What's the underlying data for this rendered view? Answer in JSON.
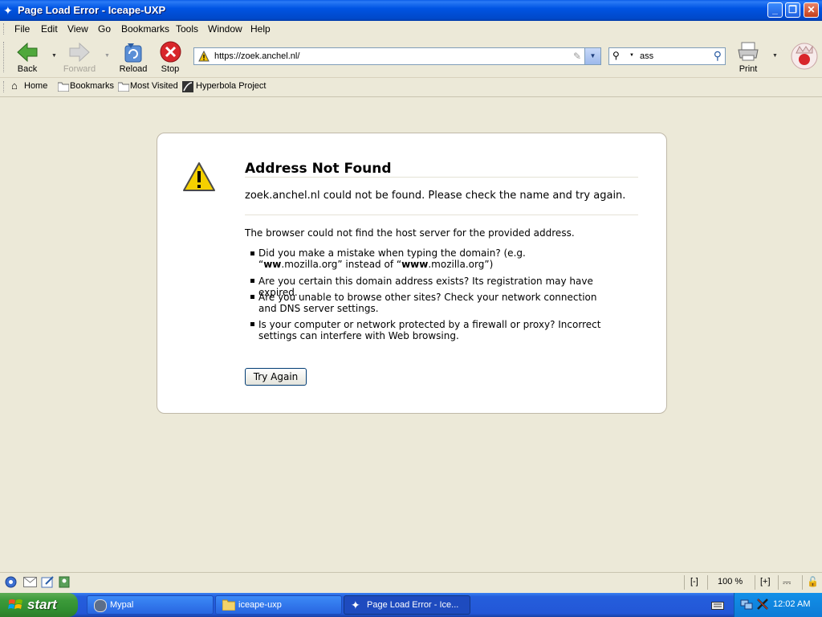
{
  "window": {
    "title": "Page Load Error - Iceape-UXP",
    "controls": [
      "minimize",
      "maximize",
      "close"
    ]
  },
  "menu": [
    "File",
    "Edit",
    "View",
    "Go",
    "Bookmarks",
    "Tools",
    "Window",
    "Help"
  ],
  "navbar": {
    "back": "Back",
    "forward": "Forward",
    "reload": "Reload",
    "stop": "Stop",
    "print": "Print",
    "url": "https://zoek.anchel.nl/",
    "search_value": "ass"
  },
  "bookmarks_bar": [
    "Home",
    "Bookmarks",
    "Most Visited",
    "Hyperbola Project"
  ],
  "error": {
    "title": "Address Not Found",
    "short_desc": "zoek.anchel.nl could not be found. Please check the name and try again.",
    "long_desc": "The browser could not find the host server for the provided address.",
    "bullets": [
      {
        "pre": "Did you make a mistake when typing the domain? (e.g. “",
        "b1": "ww",
        "mid1": ".mozilla.org” instead of “",
        "b2": "www",
        "post": ".mozilla.org”)"
      },
      {
        "text": "Are you certain this domain address exists? Its registration may have expired."
      },
      {
        "text": "Are you unable to browse other sites? Check your network connection and DNS server settings."
      },
      {
        "text": "Is your computer or network protected by a firewall or proxy? Incorrect settings can interfere with Web browsing."
      }
    ],
    "try_again": "Try Again"
  },
  "statusbar": {
    "zoom_out": "[-]",
    "zoom": "100 %",
    "zoom_in": "[+]"
  },
  "taskbar": {
    "start": "start",
    "tasks": [
      "Mypal",
      "iceape-uxp",
      "Page Load Error - Ice..."
    ],
    "clock": "12:02 AM"
  },
  "colors": {
    "titlebar": "#0054E3",
    "background": "#ECE9D8",
    "start_button": "#3C9A3A",
    "taskbar": "#245EDC"
  }
}
